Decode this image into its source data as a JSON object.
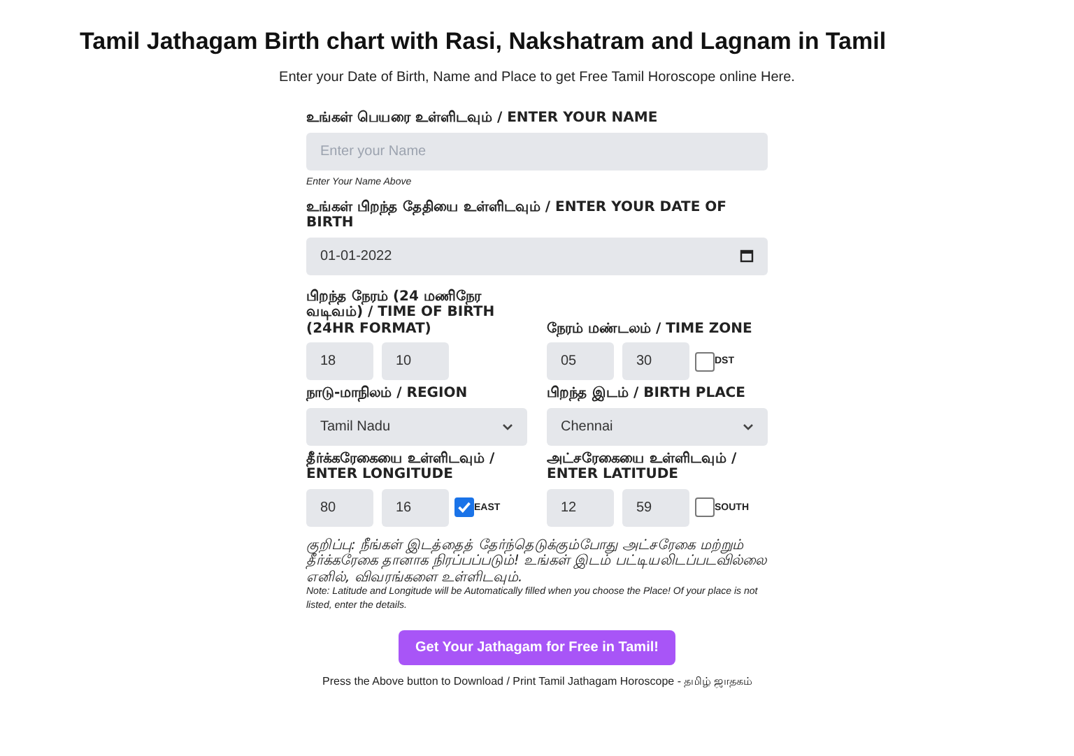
{
  "title": "Tamil Jathagam Birth chart with Rasi, Nakshatram and Lagnam in Tamil",
  "subtitle": "Enter your Date of Birth, Name and Place to get Free Tamil Horoscope online Here.",
  "form": {
    "name": {
      "label": "உங்கள் பெயரை உள்ளிடவும் / ENTER YOUR NAME",
      "placeholder": "Enter your Name",
      "hint": "Enter Your Name Above"
    },
    "dob": {
      "label": "உங்கள் பிறந்த தேதியை உள்ளிடவும் / ENTER YOUR DATE OF BIRTH",
      "value": "01-01-2022"
    },
    "time_of_birth": {
      "label": "பிறந்த நேரம் (24 மணிநேர வடிவம்) / TIME OF BIRTH (24HR FORMAT)",
      "hour": "18",
      "minute": "10"
    },
    "time_zone": {
      "label": "நேரம் மண்டலம் / TIME ZONE",
      "hour": "05",
      "minute": "30",
      "dst": {
        "label": "DST",
        "checked": false
      }
    },
    "region": {
      "label": "நாடு-மாநிலம் / REGION",
      "value": "Tamil Nadu"
    },
    "birth_place": {
      "label": "பிறந்த இடம் / BIRTH PLACE",
      "value": "Chennai"
    },
    "longitude": {
      "label": "தீர்க்கரேகையை உள்ளிடவும் / ENTER LONGITUDE",
      "degrees": "80",
      "minutes": "16",
      "direction": {
        "label": "EAST",
        "checked": true
      }
    },
    "latitude": {
      "label": "அட்சரேகையை உள்ளிடவும் / ENTER LATITUDE",
      "degrees": "12",
      "minutes": "59",
      "direction": {
        "label": "SOUTH",
        "checked": false
      }
    },
    "note_tamil": "குறிப்பு: நீங்கள் இடத்தைத் தேர்ந்தெடுக்கும்போது அட்சரேகை மற்றும் தீர்க்கரேகை தானாக நிரப்பப்படும்! உங்கள் இடம் பட்டியலிடப்படவில்லை எனில், விவரங்களை உள்ளிடவும்.",
    "note_english": "Note: Latitude and Longitude will be Automatically filled when you choose the Place! Of your place is not listed, enter the details."
  },
  "submit_button": "Get Your Jathagam for Free in Tamil!",
  "footer": "Press the Above button to Download / Print Tamil Jathagam Horoscope - தமிழ் ஜாதகம்"
}
